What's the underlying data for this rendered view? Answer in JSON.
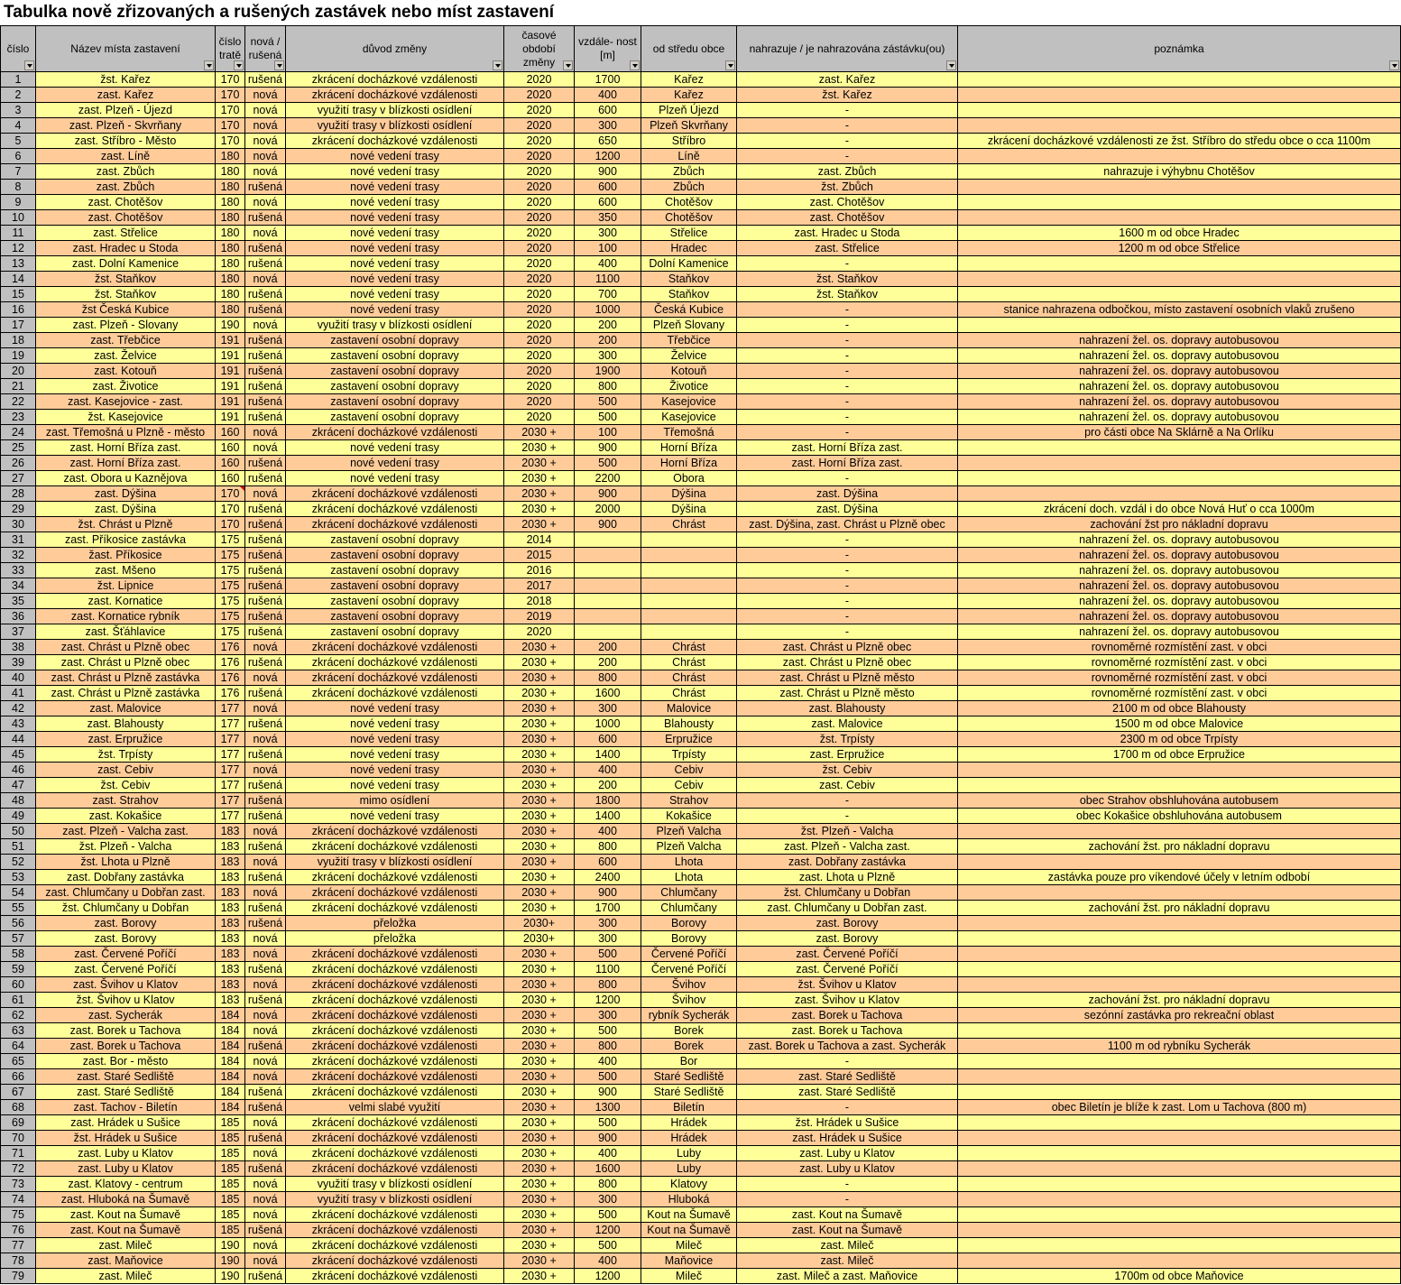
{
  "title": "Tabulka nově zřizovaných a rušených zastávek nebo míst zastavení",
  "headers": [
    "číslo",
    "Název místa zastavení",
    "číslo tratě",
    "nová / rušená",
    "důvod změny",
    "časové období změny",
    "vzdále- nost [m]",
    "od středu obce",
    "nahrazuje / je nahrazována zástávku(ou)",
    "poznámka"
  ],
  "colors": {
    "header": "#c0c0c0",
    "row_yellow": "#ffff99",
    "row_orange": "#ffcc99"
  },
  "rows": [
    [
      "1",
      "žst. Kařez",
      "170",
      "rušená",
      "zkrácení docházkové vzdálenosti",
      "2020",
      "1700",
      "Kařez",
      "zast. Kařez",
      ""
    ],
    [
      "2",
      "zast. Kařez",
      "170",
      "nová",
      "zkrácení docházkové vzdálenosti",
      "2020",
      "400",
      "Kařez",
      "žst. Kařez",
      ""
    ],
    [
      "3",
      "zast. Plzeň - Újezd",
      "170",
      "nová",
      "využití trasy v blízkosti osídlení",
      "2020",
      "600",
      "Plzeň Újezd",
      "-",
      ""
    ],
    [
      "4",
      "zast. Plzeň - Skvrňany",
      "170",
      "nová",
      "využití trasy v blízkosti osídlení",
      "2020",
      "300",
      "Plzeň Skvrňany",
      "-",
      ""
    ],
    [
      "5",
      "zast. Stříbro - Město",
      "170",
      "nová",
      "zkrácení docházkové vzdálenosti",
      "2020",
      "650",
      "Stříbro",
      "-",
      "zkrácení docházkové vzdálenosti ze žst. Stříbro do středu obce o cca 1100m"
    ],
    [
      "6",
      "zast. Líně",
      "180",
      "nová",
      "nové vedení trasy",
      "2020",
      "1200",
      "Líně",
      "-",
      ""
    ],
    [
      "7",
      "zast. Zbůch",
      "180",
      "nová",
      "nové vedení trasy",
      "2020",
      "900",
      "Zbůch",
      "zast. Zbůch",
      "nahrazuje i výhybnu Chotěšov"
    ],
    [
      "8",
      "zast. Zbůch",
      "180",
      "rušená",
      "nové vedení trasy",
      "2020",
      "600",
      "Zbůch",
      "žst. Zbůch",
      ""
    ],
    [
      "9",
      "zast. Chotěšov",
      "180",
      "nová",
      "nové vedení trasy",
      "2020",
      "600",
      "Chotěšov",
      "zast. Chotěšov",
      ""
    ],
    [
      "10",
      "zast. Chotěšov",
      "180",
      "rušená",
      "nové vedení trasy",
      "2020",
      "350",
      "Chotěšov",
      "zast. Chotěšov",
      ""
    ],
    [
      "11",
      "zast. Střelice",
      "180",
      "nová",
      "nové vedení trasy",
      "2020",
      "300",
      "Střelice",
      "zast. Hradec u Stoda",
      "1600 m od obce Hradec"
    ],
    [
      "12",
      "zast. Hradec u Stoda",
      "180",
      "rušená",
      "nové vedení trasy",
      "2020",
      "100",
      "Hradec",
      "zast. Střelice",
      "1200 m od obce Střelice"
    ],
    [
      "13",
      "zast. Dolní Kamenice",
      "180",
      "rušená",
      "nové vedení trasy",
      "2020",
      "400",
      "Dolní Kamenice",
      "-",
      ""
    ],
    [
      "14",
      "žst. Staňkov",
      "180",
      "nová",
      "nové vedení trasy",
      "2020",
      "1100",
      "Staňkov",
      "žst. Staňkov",
      ""
    ],
    [
      "15",
      "žst. Staňkov",
      "180",
      "rušená",
      "nové vedení trasy",
      "2020",
      "700",
      "Staňkov",
      "žst. Staňkov",
      ""
    ],
    [
      "16",
      "žst Česká Kubice",
      "180",
      "rušená",
      "nové vedení trasy",
      "2020",
      "1000",
      "Česká Kubice",
      "-",
      "stanice nahrazena odbočkou, místo zastavení osobních vlaků zrušeno"
    ],
    [
      "17",
      "zast. Plzeň - Slovany",
      "190",
      "nová",
      "využití trasy v blízkosti osídlení",
      "2020",
      "200",
      "Plzeň Slovany",
      "-",
      ""
    ],
    [
      "18",
      "zast. Třebčice",
      "191",
      "rušená",
      "zastavení osobní dopravy",
      "2020",
      "200",
      "Třebčice",
      "-",
      "nahrazení žel. os. dopravy autobusovou"
    ],
    [
      "19",
      "zast. Želvice",
      "191",
      "rušená",
      "zastavení osobní dopravy",
      "2020",
      "300",
      "Želvice",
      "-",
      "nahrazení žel. os. dopravy autobusovou"
    ],
    [
      "20",
      "zast. Kotouň",
      "191",
      "rušená",
      "zastavení osobní dopravy",
      "2020",
      "1900",
      "Kotouň",
      "-",
      "nahrazení žel. os. dopravy autobusovou"
    ],
    [
      "21",
      "zast. Životice",
      "191",
      "rušená",
      "zastavení osobní dopravy",
      "2020",
      "800",
      "Životice",
      "-",
      "nahrazení žel. os. dopravy autobusovou"
    ],
    [
      "22",
      "zast. Kasejovice - zast.",
      "191",
      "rušená",
      "zastavení osobní dopravy",
      "2020",
      "500",
      "Kasejovice",
      "-",
      "nahrazení žel. os. dopravy autobusovou"
    ],
    [
      "23",
      "žst. Kasejovice",
      "191",
      "rušená",
      "zastavení osobní dopravy",
      "2020",
      "500",
      "Kasejovice",
      "-",
      "nahrazení žel. os. dopravy autobusovou"
    ],
    [
      "24",
      "zast. Třemošná u Plzně - město",
      "160",
      "nová",
      "zkrácení docházkové vzdálenosti",
      "2030 +",
      "100",
      "Třemošná",
      "-",
      "pro části obce Na Sklárně a Na Orlíku"
    ],
    [
      "25",
      "zast. Horní Bříza zast.",
      "160",
      "nová",
      "nové vedení trasy",
      "2030 +",
      "900",
      "Horní Bříza",
      "zast. Horní Bříza zast.",
      ""
    ],
    [
      "26",
      "zast. Horní Bříza zast.",
      "160",
      "rušená",
      "nové vedení trasy",
      "2030 +",
      "500",
      "Horní Bříza",
      "zast. Horní Bříza zast.",
      ""
    ],
    [
      "27",
      "zast. Obora u Kaznějova",
      "160",
      "rušená",
      "nové vedení trasy",
      "2030 +",
      "2200",
      "Obora",
      "-",
      ""
    ],
    [
      "28",
      "zast. Dýšina",
      "170",
      "nová",
      "zkrácení docházkové vzdálenosti",
      "2030 +",
      "900",
      "Dýšina",
      "zast. Dýšina",
      ""
    ],
    [
      "29",
      "zast. Dýšina",
      "170",
      "rušená",
      "zkrácení docházkové vzdálenosti",
      "2030 +",
      "2000",
      "Dýšina",
      "zast. Dýšina",
      "zkrácení doch. vzdál i do obce Nová Huť o cca 1000m"
    ],
    [
      "30",
      "žst. Chrást u Plzně",
      "170",
      "rušená",
      "zkrácení docházkové vzdálenosti",
      "2030 +",
      "900",
      "Chrást",
      "zast. Dýšina, zast. Chrást u Plzně obec",
      "zachování žst pro nákladní dopravu"
    ],
    [
      "31",
      "zast. Příkosice zastávka",
      "175",
      "rušená",
      "zastavení osobní dopravy",
      "2014",
      "",
      "",
      "-",
      "nahrazení žel. os. dopravy autobusovou"
    ],
    [
      "32",
      "žast. Příkosice",
      "175",
      "rušená",
      "zastavení osobní dopravy",
      "2015",
      "",
      "",
      "-",
      "nahrazení žel. os. dopravy autobusovou"
    ],
    [
      "33",
      "zast. Mšeno",
      "175",
      "rušená",
      "zastavení osobní dopravy",
      "2016",
      "",
      "",
      "-",
      "nahrazení žel. os. dopravy autobusovou"
    ],
    [
      "34",
      "žst. Lipnice",
      "175",
      "rušená",
      "zastavení osobní dopravy",
      "2017",
      "",
      "",
      "-",
      "nahrazení žel. os. dopravy autobusovou"
    ],
    [
      "35",
      "zast. Kornatice",
      "175",
      "rušená",
      "zastavení osobní dopravy",
      "2018",
      "",
      "",
      "-",
      "nahrazení žel. os. dopravy autobusovou"
    ],
    [
      "36",
      "zast. Kornatice rybník",
      "175",
      "rušená",
      "zastavení osobní dopravy",
      "2019",
      "",
      "",
      "-",
      "nahrazení žel. os. dopravy autobusovou"
    ],
    [
      "37",
      "zast. Šťáhlavice",
      "175",
      "rušená",
      "zastavení osobní dopravy",
      "2020",
      "",
      "",
      "-",
      "nahrazení žel. os. dopravy autobusovou"
    ],
    [
      "38",
      "zast. Chrást u Plzně obec",
      "176",
      "nová",
      "zkrácení docházkové vzdálenosti",
      "2030 +",
      "200",
      "Chrást",
      "zast. Chrást u Plzně obec",
      "rovnoměrné rozmístění zast. v obci"
    ],
    [
      "39",
      "zast. Chrást u Plzně obec",
      "176",
      "rušená",
      "zkrácení docházkové vzdálenosti",
      "2030 +",
      "200",
      "Chrást",
      "zast. Chrást u Plzně obec",
      "rovnoměrné rozmístění zast. v obci"
    ],
    [
      "40",
      "zast. Chrást u Plzně zastávka",
      "176",
      "nová",
      "zkrácení docházkové vzdálenosti",
      "2030 +",
      "800",
      "Chrást",
      "zast. Chrást u Plzně město",
      "rovnoměrné rozmístění zast. v obci"
    ],
    [
      "41",
      "zast. Chrást u Plzně zastávka",
      "176",
      "rušená",
      "zkrácení docházkové vzdálenosti",
      "2030 +",
      "1600",
      "Chrást",
      "zast. Chrást u Plzně město",
      "rovnoměrné rozmístění zast. v obci"
    ],
    [
      "42",
      "zast. Malovice",
      "177",
      "nová",
      "nové vedení trasy",
      "2030 +",
      "300",
      "Malovice",
      "zast. Blahousty",
      "2100 m od obce Blahousty"
    ],
    [
      "43",
      "zast. Blahousty",
      "177",
      "rušená",
      "nové vedení trasy",
      "2030 +",
      "1000",
      "Blahousty",
      "zast. Malovice",
      "1500 m od obce Malovice"
    ],
    [
      "44",
      "zast. Erpružice",
      "177",
      "nová",
      "nové vedení trasy",
      "2030 +",
      "600",
      "Erpružice",
      "žst. Trpísty",
      "2300 m od obce Trpísty"
    ],
    [
      "45",
      "žst. Trpísty",
      "177",
      "rušená",
      "nové vedení trasy",
      "2030 +",
      "1400",
      "Trpísty",
      "zast. Erpružice",
      "1700 m od obce Erpružice"
    ],
    [
      "46",
      "zast. Cebiv",
      "177",
      "nová",
      "nové vedení trasy",
      "2030 +",
      "400",
      "Cebiv",
      "žst. Cebiv",
      ""
    ],
    [
      "47",
      "žst. Cebiv",
      "177",
      "rušená",
      "nové vedení trasy",
      "2030 +",
      "200",
      "Cebiv",
      "zast. Cebiv",
      ""
    ],
    [
      "48",
      "zast. Strahov",
      "177",
      "rušená",
      "mimo osídlení",
      "2030 +",
      "1800",
      "Strahov",
      "-",
      "obec Strahov obshluhována autobusem"
    ],
    [
      "49",
      "zast. Kokašice",
      "177",
      "rušená",
      "nové vedení trasy",
      "2030 +",
      "1400",
      "Kokašice",
      "-",
      "obec Kokašice obshluhována autobusem"
    ],
    [
      "50",
      "zast. Plzeň - Valcha zast.",
      "183",
      "nová",
      "zkrácení docházkové vzdálenosti",
      "2030 +",
      "400",
      "Plzeň Valcha",
      "žst. Plzeň - Valcha",
      ""
    ],
    [
      "51",
      "žst. Plzeň - Valcha",
      "183",
      "rušená",
      "zkrácení docházkové vzdálenosti",
      "2030 +",
      "800",
      "Plzeň Valcha",
      "zast. Plzeň - Valcha zast.",
      "zachování žst. pro nákladní dopravu"
    ],
    [
      "52",
      "žst. Lhota u Plzně",
      "183",
      "nová",
      "využití trasy v blízkosti osídlení",
      "2030 +",
      "600",
      "Lhota",
      "zast. Dobřany zastávka",
      ""
    ],
    [
      "53",
      "zast. Dobřany zastávka",
      "183",
      "rušená",
      "zkrácení docházkové vzdálenosti",
      "2030 +",
      "2400",
      "Lhota",
      "zast. Lhota u Plzně",
      "zastávka pouze pro víkendové účely v letním odbobí"
    ],
    [
      "54",
      "zast. Chlumčany u Dobřan zast.",
      "183",
      "nová",
      "zkrácení docházkové vzdálenosti",
      "2030 +",
      "900",
      "Chlumčany",
      "žst. Chlumčany u Dobřan",
      ""
    ],
    [
      "55",
      "žst. Chlumčany u Dobřan",
      "183",
      "rušená",
      "zkrácení docházkové vzdálenosti",
      "2030 +",
      "1700",
      "Chlumčany",
      "zast. Chlumčany u Dobřan zast.",
      "zachování žst. pro nákladní dopravu"
    ],
    [
      "56",
      "zast. Borovy",
      "183",
      "rušená",
      "přeložka",
      "2030+",
      "300",
      "Borovy",
      "zast. Borovy",
      ""
    ],
    [
      "57",
      "zast. Borovy",
      "183",
      "nová",
      "přeložka",
      "2030+",
      "300",
      "Borovy",
      "zast. Borovy",
      ""
    ],
    [
      "58",
      "zast. Červené Poříčí",
      "183",
      "nová",
      "zkrácení docházkové vzdálenosti",
      "2030 +",
      "500",
      "Červené Poříčí",
      "zast. Červené Poříčí",
      ""
    ],
    [
      "59",
      "zast. Červené Poříčí",
      "183",
      "rušená",
      "zkrácení docházkové vzdálenosti",
      "2030 +",
      "1100",
      "Červené Poříčí",
      "zast. Červené Poříčí",
      ""
    ],
    [
      "60",
      "zast. Švihov u Klatov",
      "183",
      "nová",
      "zkrácení docházkové vzdálenosti",
      "2030 +",
      "800",
      "Švihov",
      "žst. Švihov u Klatov",
      ""
    ],
    [
      "61",
      "žst. Švihov u Klatov",
      "183",
      "rušená",
      "zkrácení docházkové vzdálenosti",
      "2030 +",
      "1200",
      "Švihov",
      "zast. Švihov u Klatov",
      "zachování žst. pro nákladní dopravu"
    ],
    [
      "62",
      "zast. Sycherák",
      "184",
      "nová",
      "zkrácení docházkové vzdálenosti",
      "2030 +",
      "300",
      "rybník Sycherák",
      "zast. Borek u Tachova",
      "sezónní zastávka pro rekreační oblast"
    ],
    [
      "63",
      "zast. Borek u Tachova",
      "184",
      "nová",
      "zkrácení docházkové vzdálenosti",
      "2030 +",
      "500",
      "Borek",
      "zast. Borek u Tachova",
      ""
    ],
    [
      "64",
      "zast. Borek u Tachova",
      "184",
      "rušená",
      "zkrácení docházkové vzdálenosti",
      "2030 +",
      "800",
      "Borek",
      "zast. Borek u Tachova a zast. Sycherák",
      "1100 m od rybníku Sycherák"
    ],
    [
      "65",
      "zast. Bor - město",
      "184",
      "nová",
      "zkrácení docházkové vzdálenosti",
      "2030 +",
      "400",
      "Bor",
      "-",
      ""
    ],
    [
      "66",
      "zast. Staré Sedliště",
      "184",
      "nová",
      "zkrácení docházkové vzdálenosti",
      "2030 +",
      "500",
      "Staré Sedliště",
      "zast. Staré Sedliště",
      ""
    ],
    [
      "67",
      "zast. Staré Sedliště",
      "184",
      "rušená",
      "zkrácení docházkové vzdálenosti",
      "2030 +",
      "900",
      "Staré Sedliště",
      "zast. Staré Sedliště",
      ""
    ],
    [
      "68",
      "zast. Tachov - Biletín",
      "184",
      "rušená",
      "velmi slabé využití",
      "2030 +",
      "1300",
      "Biletín",
      "-",
      "obec Biletín je blíže k zast. Lom u Tachova (800 m)"
    ],
    [
      "69",
      "zast. Hrádek u Sušice",
      "185",
      "nová",
      "zkrácení docházkové vzdálenosti",
      "2030 +",
      "500",
      "Hrádek",
      "žst. Hrádek u Sušice",
      ""
    ],
    [
      "70",
      "žst. Hrádek u Sušice",
      "185",
      "rušená",
      "zkrácení docházkové vzdálenosti",
      "2030 +",
      "900",
      "Hrádek",
      "zast. Hrádek u Sušice",
      ""
    ],
    [
      "71",
      "zast. Luby u Klatov",
      "185",
      "nová",
      "zkrácení docházkové vzdálenosti",
      "2030 +",
      "400",
      "Luby",
      "zast. Luby u Klatov",
      ""
    ],
    [
      "72",
      "zast. Luby u Klatov",
      "185",
      "rušená",
      "zkrácení docházkové vzdálenosti",
      "2030 +",
      "1600",
      "Luby",
      "zast. Luby u Klatov",
      ""
    ],
    [
      "73",
      "zast. Klatovy - centrum",
      "185",
      "nová",
      "využití trasy v blízkosti osídlení",
      "2030 +",
      "800",
      "Klatovy",
      "-",
      ""
    ],
    [
      "74",
      "zast. Hluboká na Šumavě",
      "185",
      "nová",
      "využití trasy v blízkosti osídlení",
      "2030 +",
      "300",
      "Hluboká",
      "-",
      ""
    ],
    [
      "75",
      "zast. Kout na Šumavě",
      "185",
      "nová",
      "zkrácení docházkové vzdálenosti",
      "2030 +",
      "500",
      "Kout na Šumavě",
      "zast. Kout na Šumavě",
      ""
    ],
    [
      "76",
      "zast. Kout na Šumavě",
      "185",
      "rušená",
      "zkrácení docházkové vzdálenosti",
      "2030 +",
      "1200",
      "Kout na Šumavě",
      "zast. Kout na Šumavě",
      ""
    ],
    [
      "77",
      "zast. Mileč",
      "190",
      "nová",
      "zkrácení docházkové vzdálenosti",
      "2030 +",
      "500",
      "Mileč",
      "zast. Mileč",
      ""
    ],
    [
      "78",
      "zast. Maňovice",
      "190",
      "nová",
      "zkrácení docházkové vzdálenosti",
      "2030 +",
      "400",
      "Maňovice",
      "zast. Mileč",
      ""
    ],
    [
      "79",
      "zast. Mileč",
      "190",
      "rušená",
      "zkrácení docházkové vzdálenosti",
      "2030 +",
      "1200",
      "Mileč",
      "zast. Mileč a zast. Maňovice",
      "1700m od obce Maňovice"
    ]
  ]
}
